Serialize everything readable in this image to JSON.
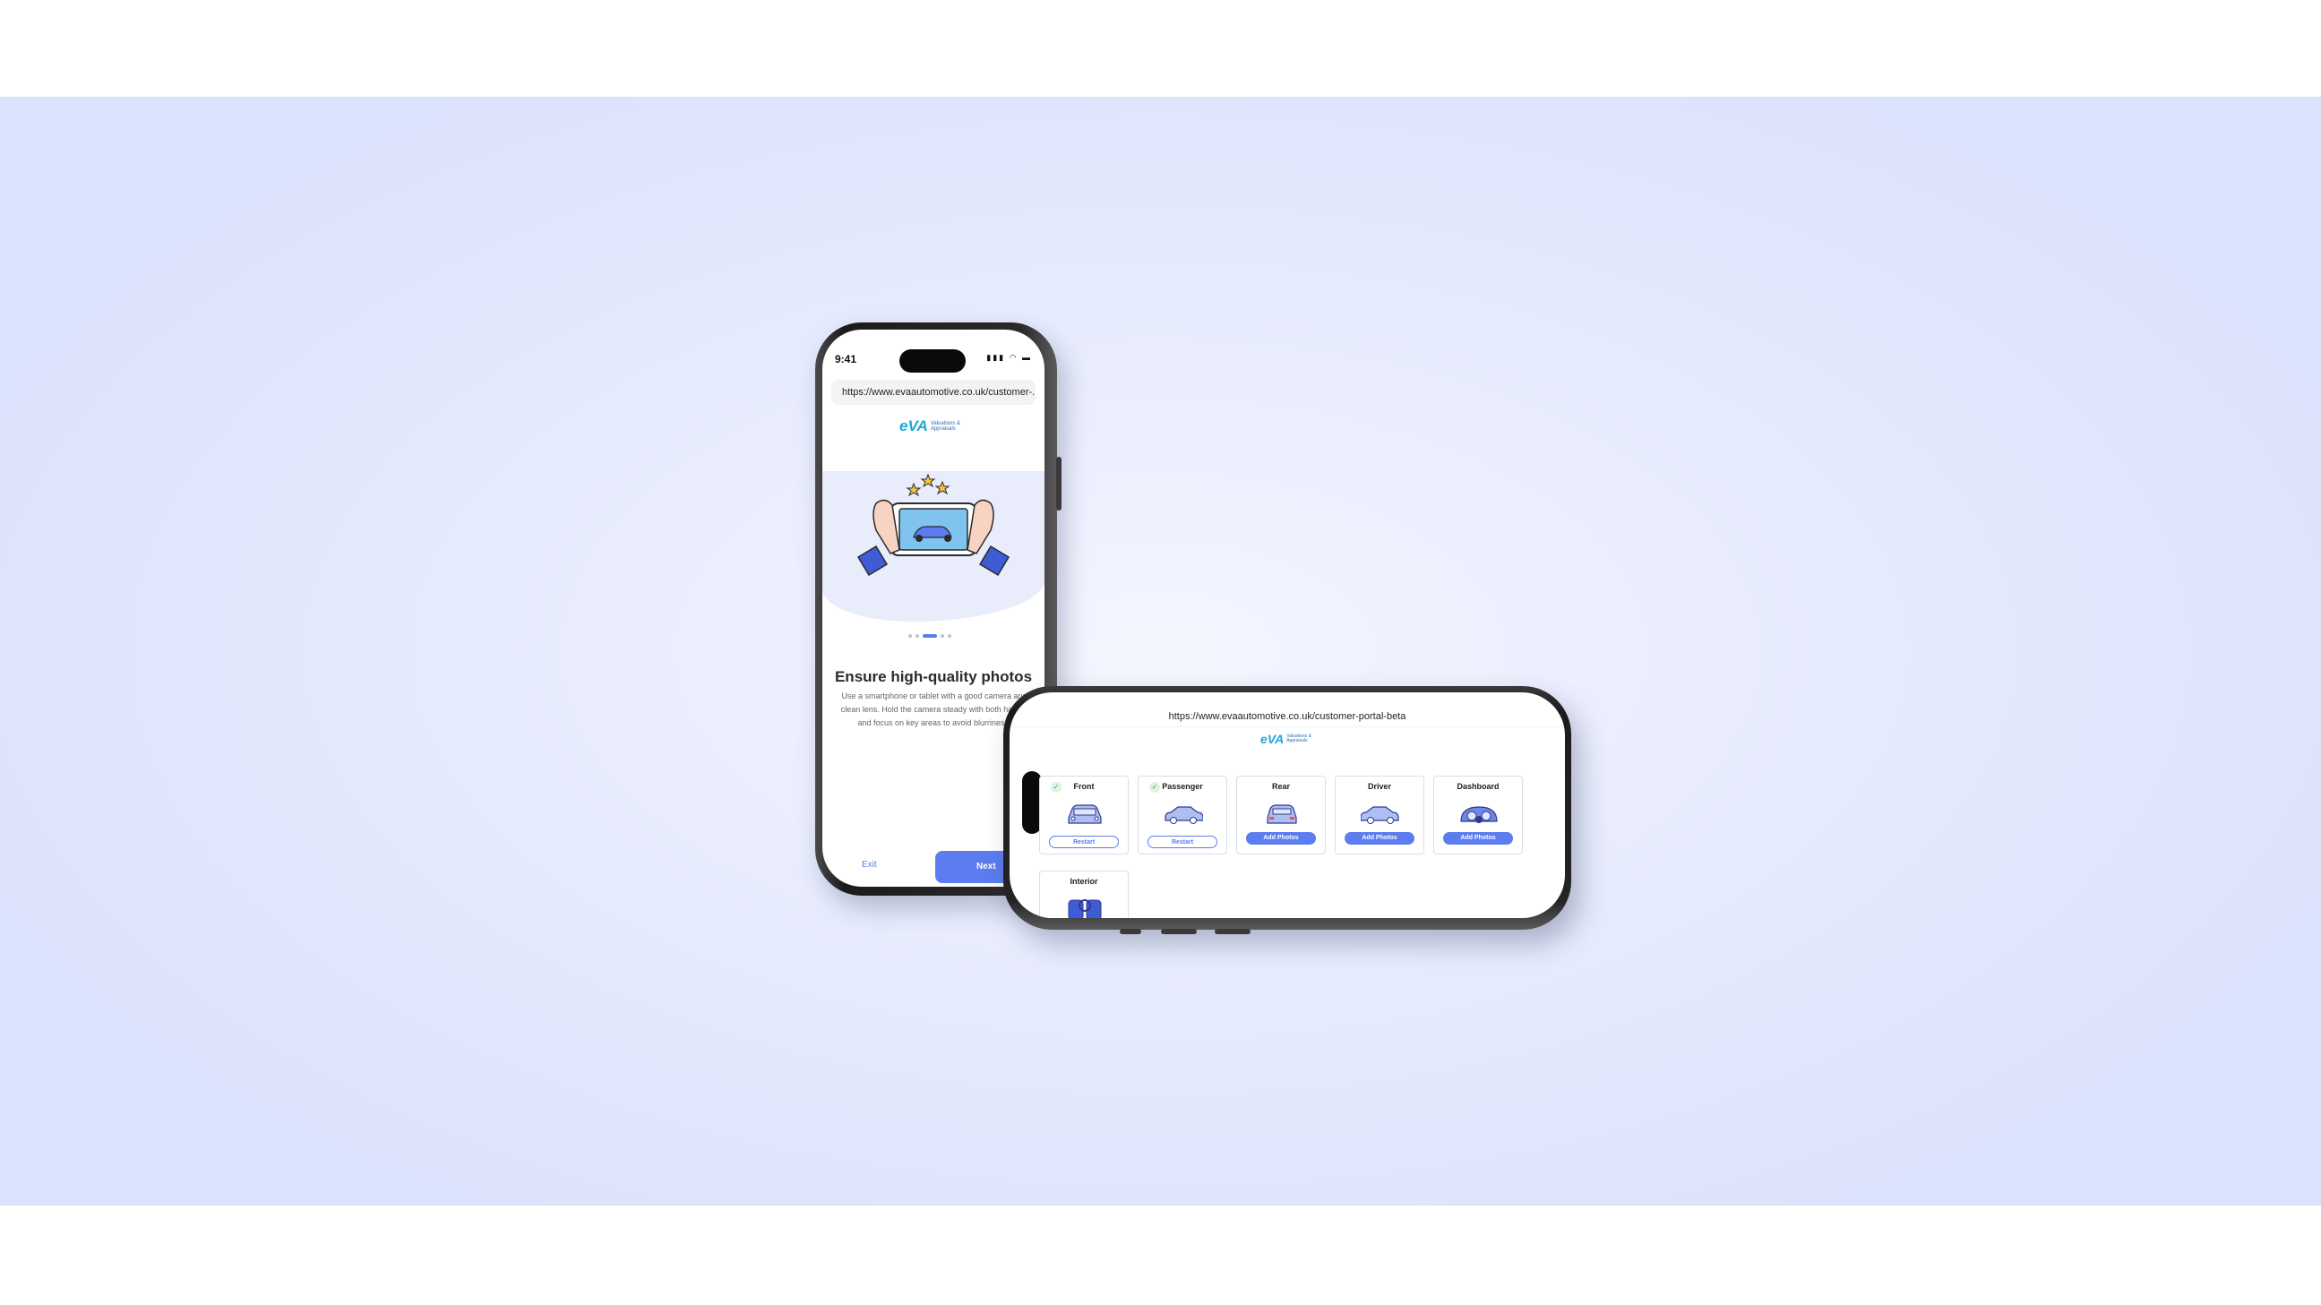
{
  "portrait": {
    "status_time": "9:41",
    "url": "https://www.evaautomotive.co.uk/customer-...",
    "logo": {
      "mark": "eVA",
      "line1": "Valuations &",
      "line2": "Appraisals"
    },
    "carousel": {
      "count": 5,
      "active_index": 2
    },
    "title": "Ensure high-quality photos",
    "body": "Use a smartphone or tablet with a good camera and clean lens. Hold the camera steady with both hands, and focus on key areas to avoid blurriness.",
    "exit_label": "Exit",
    "next_label": "Next"
  },
  "landscape": {
    "url": "https://www.evaautomotive.co.uk/customer-portal-beta",
    "logo": {
      "mark": "eVA",
      "line1": "Valuations &",
      "line2": "Appraisals"
    },
    "cards": [
      {
        "title": "Front",
        "done": true,
        "button": "Restart",
        "icon": "car-front-icon"
      },
      {
        "title": "Passenger",
        "done": true,
        "button": "Restart",
        "icon": "car-side-icon"
      },
      {
        "title": "Rear",
        "done": false,
        "button": "Add Photos",
        "icon": "car-rear-icon"
      },
      {
        "title": "Driver",
        "done": false,
        "button": "Add Photos",
        "icon": "car-side-icon"
      },
      {
        "title": "Dashboard",
        "done": false,
        "button": "Add Photos",
        "icon": "dashboard-icon"
      },
      {
        "title": "Interior",
        "done": false,
        "button": "",
        "icon": "interior-icon"
      }
    ]
  },
  "colors": {
    "accent": "#5b7df0",
    "brand": "#1aa9d6",
    "background": "#dbe2fb"
  }
}
